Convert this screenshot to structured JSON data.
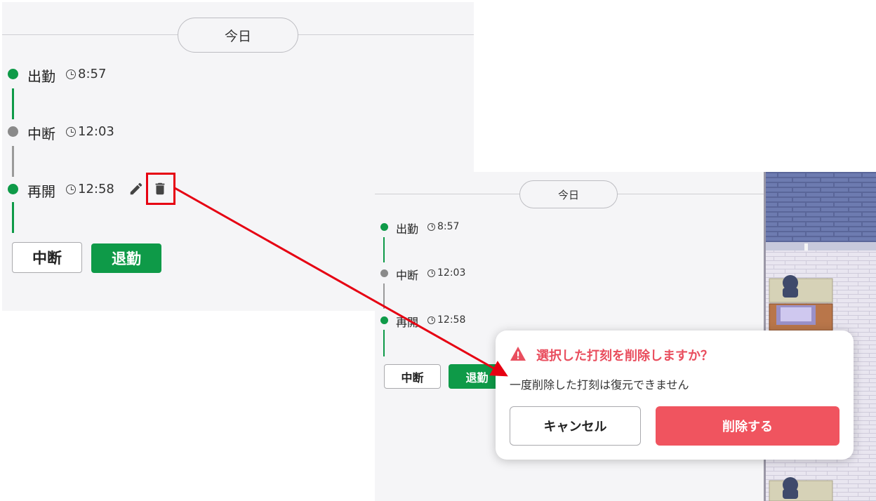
{
  "before": {
    "day_label": "今日",
    "events": [
      {
        "label": "出勤",
        "time": "8:57",
        "status": "active",
        "color": "#0e9a48"
      },
      {
        "label": "中断",
        "time": "12:03",
        "status": "break",
        "color": "#8a8a8a"
      },
      {
        "label": "再開",
        "time": "12:58",
        "status": "active",
        "color": "#0e9a48"
      }
    ],
    "buttons": {
      "pause": "中断",
      "clock_out": "退勤"
    },
    "row_icons": [
      "pencil-icon",
      "trash-icon"
    ]
  },
  "after": {
    "day_label": "今日",
    "events": [
      {
        "label": "出勤",
        "time": "8:57"
      },
      {
        "label": "中断",
        "time": "12:03"
      },
      {
        "label": "再開",
        "time": "12:58"
      }
    ],
    "buttons": {
      "pause": "中断",
      "clock_out": "退勤"
    }
  },
  "dialog": {
    "title": "選択した打刻を削除しますか？",
    "message": "一度削除した打刻は復元できません",
    "cancel": "キャンセル",
    "confirm": "削除する",
    "title_color": "#e94e5e",
    "confirm_color": "#f0545f"
  },
  "colors": {
    "highlight": "#e60012",
    "green": "#0e9a48",
    "gray": "#8a8a8a"
  }
}
